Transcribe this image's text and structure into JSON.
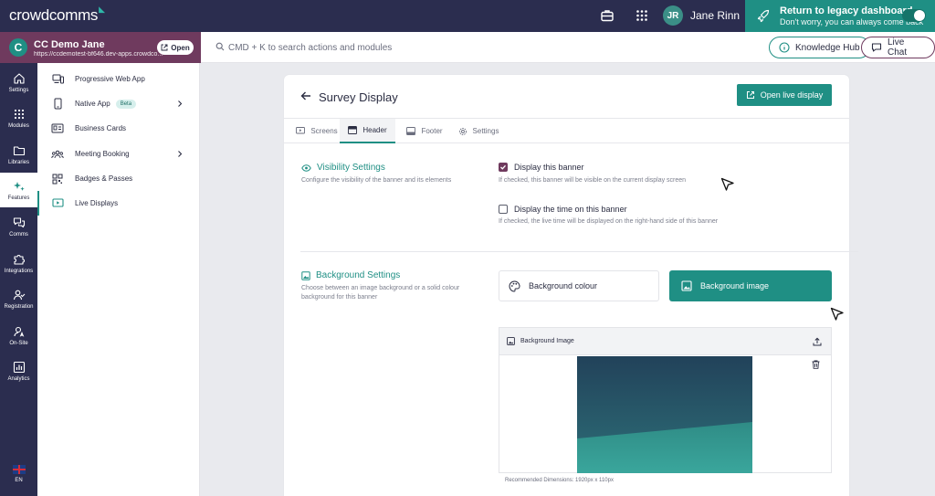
{
  "topbar": {
    "logo_text": "crowdcomms",
    "user_initials": "JR",
    "user_name": "Jane Rinn",
    "legacy_title": "Return to legacy dashboard",
    "legacy_subtitle": "Don't worry, you can always come back"
  },
  "event": {
    "name": "CC Demo Jane",
    "url": "https://ccdemotest-bf646.dev-apps.crowdco...",
    "open_label": "Open",
    "logo_letter": "C"
  },
  "search": {
    "placeholder": "CMD + K to search actions and modules"
  },
  "help": {
    "knowledge_hub": "Knowledge Hub",
    "live_chat": "Live Chat"
  },
  "rail": {
    "items": [
      {
        "label": "Settings",
        "icon": "home-icon"
      },
      {
        "label": "Modules",
        "icon": "grid-icon"
      },
      {
        "label": "Libraries",
        "icon": "folder-icon"
      },
      {
        "label": "Features",
        "icon": "sparkle-icon"
      },
      {
        "label": "Comms",
        "icon": "chat-icon"
      },
      {
        "label": "Integrations",
        "icon": "puzzle-icon"
      },
      {
        "label": "Registration",
        "icon": "user-check-icon"
      },
      {
        "label": "On-Site",
        "icon": "badge-icon"
      },
      {
        "label": "Analytics",
        "icon": "chart-icon"
      }
    ],
    "language": "EN"
  },
  "subnav": {
    "items": [
      {
        "label": "Progressive Web App"
      },
      {
        "label": "Native App",
        "badge": "Beta"
      },
      {
        "label": "Business Cards"
      },
      {
        "label": "Meeting Booking"
      },
      {
        "label": "Badges & Passes"
      },
      {
        "label": "Live Displays"
      }
    ]
  },
  "page": {
    "title": "Survey Display",
    "open_live_label": "Open live display",
    "tabs": [
      {
        "label": "Screens"
      },
      {
        "label": "Header"
      },
      {
        "label": "Footer"
      },
      {
        "label": "Settings"
      }
    ]
  },
  "visibility": {
    "title": "Visibility Settings",
    "description": "Configure the visibility of the banner and its elements",
    "display_banner_label": "Display this banner",
    "display_banner_help": "If checked, this banner will be visible on the current display screen",
    "display_banner_checked": true,
    "display_time_label": "Display the time on this banner",
    "display_time_help": "If checked, the live time will be displayed on the right-hand side of this banner",
    "display_time_checked": false
  },
  "background": {
    "title": "Background Settings",
    "description_line1": "Choose between an image background or a solid colour",
    "description_line2": "background for this banner",
    "colour_option": "Background colour",
    "image_option": "Background image",
    "selected": "image",
    "panel_title": "Background Image",
    "recommended": "Recommended Dimensions: 1920px x 110px"
  },
  "colors": {
    "navy": "#2b2d4f",
    "teal": "#1f8f84",
    "plum": "#6f3a5e"
  }
}
